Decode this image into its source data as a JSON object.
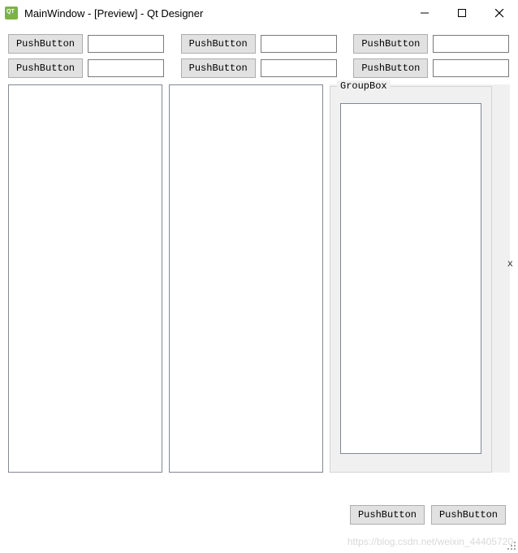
{
  "window": {
    "title": "MainWindow - [Preview] - Qt Designer"
  },
  "grid": [
    [
      {
        "btn": "PushButton",
        "val": ""
      },
      {
        "btn": "PushButton",
        "val": ""
      },
      {
        "btn": "PushButton",
        "val": ""
      }
    ],
    [
      {
        "btn": "PushButton",
        "val": ""
      },
      {
        "btn": "PushButton",
        "val": ""
      },
      {
        "btn": "PushButton",
        "val": ""
      }
    ]
  ],
  "groupbox": {
    "title": "GroupBox"
  },
  "bottom": {
    "btn1": "PushButton",
    "btn2": "PushButton"
  },
  "side_label": "x",
  "watermark": "https://blog.csdn.net/weixin_44405720"
}
